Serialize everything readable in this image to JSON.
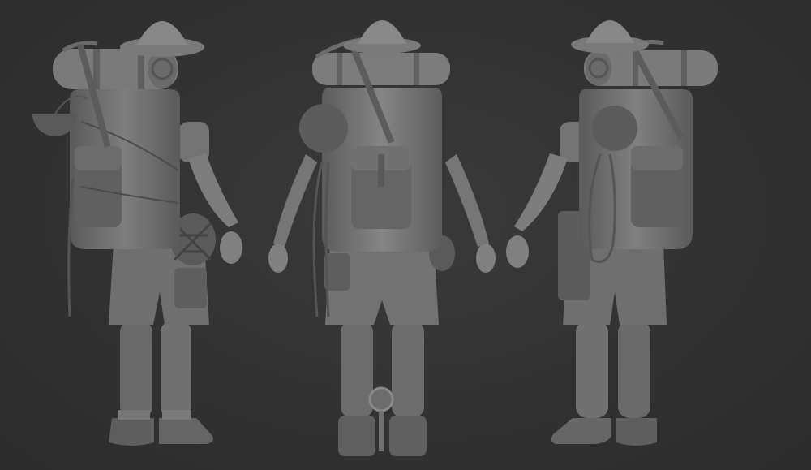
{
  "scene": {
    "views": [
      {
        "view": "back-three-quarter-left"
      },
      {
        "view": "back"
      },
      {
        "view": "back-three-quarter-right"
      }
    ],
    "colors": {
      "background": "#323232",
      "clay_light": "#8a8a8a",
      "clay_mid": "#6e6e6e",
      "clay_dark": "#4e4e4e",
      "clay_shadow": "#3c3c3c"
    }
  }
}
